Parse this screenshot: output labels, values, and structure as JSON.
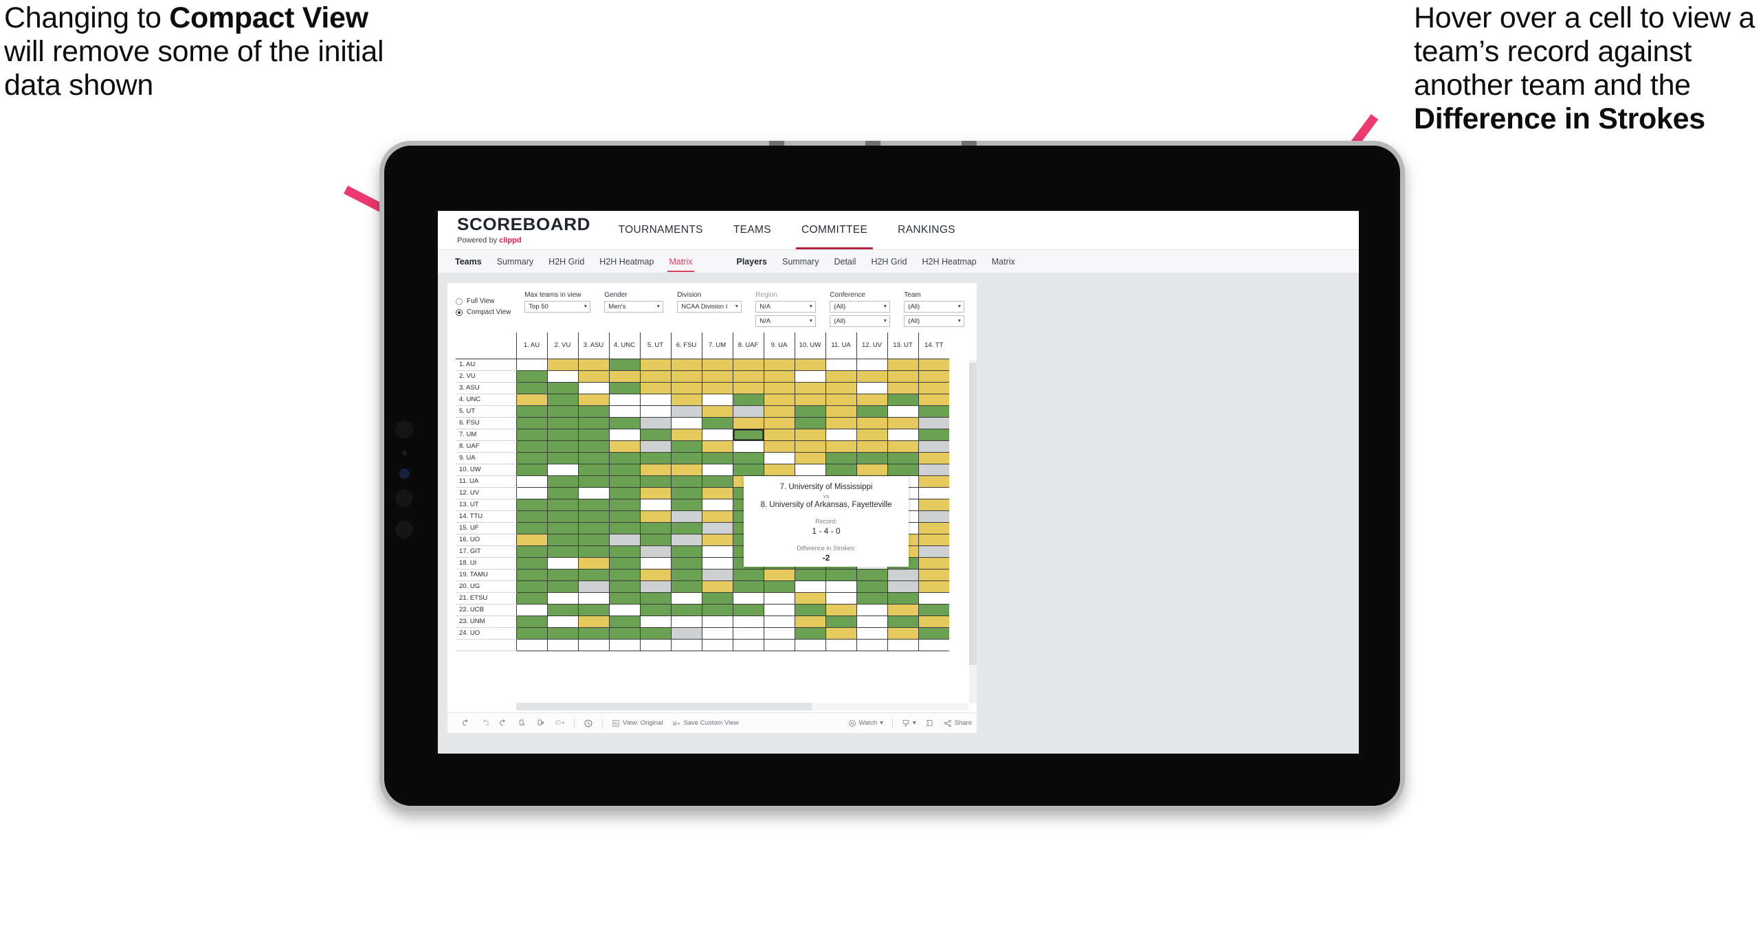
{
  "annotations": {
    "left": {
      "p1": "Changing to ",
      "b1": "Compact View",
      "p2": " will remove some of the initial data shown"
    },
    "right": {
      "p1": "Hover over a cell to view a team’s record against another team and the ",
      "b1": "Difference in Strokes"
    },
    "arrow_color": "#ec3a6f"
  },
  "app": {
    "brand": {
      "name": "SCOREBOARD",
      "powered_prefix": "Powered by ",
      "powered_brand": "clippd"
    },
    "topnav": [
      {
        "label": "TOURNAMENTS",
        "active": false
      },
      {
        "label": "TEAMS",
        "active": false
      },
      {
        "label": "COMMITTEE",
        "active": true
      },
      {
        "label": "RANKINGS",
        "active": false
      }
    ],
    "subnav": {
      "teams_group": [
        {
          "label": "Teams",
          "kind": "head"
        },
        {
          "label": "Summary",
          "kind": "item"
        },
        {
          "label": "H2H Grid",
          "kind": "item"
        },
        {
          "label": "H2H Heatmap",
          "kind": "item"
        },
        {
          "label": "Matrix",
          "kind": "selected"
        }
      ],
      "players_group": [
        {
          "label": "Players",
          "kind": "head"
        },
        {
          "label": "Summary",
          "kind": "item"
        },
        {
          "label": "Detail",
          "kind": "item"
        },
        {
          "label": "H2H Grid",
          "kind": "item"
        },
        {
          "label": "H2H Heatmap",
          "kind": "item"
        },
        {
          "label": "Matrix",
          "kind": "item"
        }
      ]
    }
  },
  "filters": {
    "view_mode": {
      "full_label": "Full View",
      "compact_label": "Compact View",
      "selected": "Compact View"
    },
    "max_teams": {
      "label": "Max teams in view",
      "value": "Top 50"
    },
    "gender": {
      "label": "Gender",
      "value": "Men's"
    },
    "division": {
      "label": "Division",
      "value": "NCAA Division I"
    },
    "region": {
      "label": "Region",
      "value1": "N/A",
      "value2": "N/A"
    },
    "conference": {
      "label": "Conference",
      "value1": "(All)",
      "value2": "(All)"
    },
    "team": {
      "label": "Team",
      "value1": "(All)",
      "value2": "(All)"
    }
  },
  "tooltip": {
    "team_a": "7. University of Mississippi",
    "vs": "vs",
    "team_b": "8. University of Arkansas, Fayetteville",
    "record_label": "Record:",
    "record_value": "1 - 4 - 0",
    "diff_label": "Difference in Strokes:",
    "diff_value": "-2"
  },
  "toolbar": {
    "items": [
      {
        "name": "undo",
        "label": "",
        "icon": "undo-icon"
      },
      {
        "name": "redo",
        "label": "",
        "icon": "redo-icon"
      },
      {
        "name": "revert",
        "label": "",
        "icon": "revert-icon"
      },
      {
        "name": "refresh",
        "label": "",
        "icon": "refresh-data-icon"
      },
      {
        "name": "pause",
        "label": "",
        "icon": "pause-updates-icon"
      },
      {
        "name": "alerts",
        "label": "",
        "icon": "alert-icon"
      }
    ],
    "view_original": "View: Original",
    "save_custom_view": "Save Custom View",
    "watch": "Watch",
    "share": "Share"
  },
  "chart_data": {
    "type": "heatmap",
    "title": "Team Head-to-Head Matrix",
    "legend_colors": {
      "win": "#6aa152",
      "loss": "#e5cb5d",
      "tie": "#cfd0d1",
      "none": "#ffffff"
    },
    "columns": [
      "1. AU",
      "2. VU",
      "3. ASU",
      "4. UNC",
      "5. UT",
      "6. FSU",
      "7. UM",
      "8. UAF",
      "9. UA",
      "10. UW",
      "11. UA",
      "12. UV",
      "13. UT",
      "14. TT"
    ],
    "rows": [
      "1. AU",
      "2. VU",
      "3. ASU",
      "4. UNC",
      "5. UT",
      "6. FSU",
      "7. UM",
      "8. UAF",
      "9. UA",
      "10. UW",
      "11. UA",
      "12. UV",
      "13. UT",
      "14. TTU",
      "15. UF",
      "16. UO",
      "17. GIT",
      "18. UI",
      "19. TAMU",
      "20. UG",
      "21. ETSU",
      "22. UCB",
      "23. UNM",
      "24. UO"
    ],
    "selected_cell": {
      "row": "7. UM",
      "col": "8. UAF"
    },
    "cells": [
      [
        "w",
        "y",
        "y",
        "g",
        "y",
        "y",
        "y",
        "y",
        "y",
        "y",
        "w",
        "w",
        "y",
        "y"
      ],
      [
        "g",
        "w",
        "y",
        "y",
        "y",
        "y",
        "y",
        "y",
        "y",
        "w",
        "y",
        "y",
        "y",
        "y"
      ],
      [
        "g",
        "g",
        "w",
        "g",
        "y",
        "y",
        "y",
        "y",
        "y",
        "y",
        "y",
        "w",
        "y",
        "y"
      ],
      [
        "y",
        "g",
        "y",
        "w",
        "w",
        "y",
        "w",
        "g",
        "y",
        "y",
        "y",
        "y",
        "g",
        "y"
      ],
      [
        "g",
        "g",
        "g",
        "w",
        "w",
        "s",
        "y",
        "s",
        "y",
        "g",
        "y",
        "g",
        "w",
        "g"
      ],
      [
        "g",
        "g",
        "g",
        "g",
        "s",
        "w",
        "g",
        "y",
        "y",
        "g",
        "y",
        "y",
        "y",
        "s"
      ],
      [
        "g",
        "g",
        "g",
        "w",
        "g",
        "y",
        "w",
        "g",
        "y",
        "y",
        "w",
        "y",
        "w",
        "g"
      ],
      [
        "g",
        "g",
        "g",
        "y",
        "s",
        "g",
        "y",
        "w",
        "y",
        "y",
        "y",
        "y",
        "y",
        "s"
      ],
      [
        "g",
        "g",
        "g",
        "g",
        "g",
        "g",
        "g",
        "g",
        "w",
        "y",
        "g",
        "g",
        "g",
        "y"
      ],
      [
        "g",
        "w",
        "g",
        "g",
        "y",
        "y",
        "w",
        "g",
        "y",
        "w",
        "g",
        "y",
        "g",
        "s"
      ],
      [
        "w",
        "g",
        "g",
        "g",
        "g",
        "g",
        "g",
        "y",
        "g",
        "w",
        "w",
        "g",
        "w",
        "y"
      ],
      [
        "w",
        "g",
        "w",
        "g",
        "y",
        "g",
        "y",
        "g",
        "g",
        "g",
        "w",
        "w",
        "w",
        "w"
      ],
      [
        "g",
        "g",
        "g",
        "g",
        "w",
        "g",
        "w",
        "g",
        "g",
        "g",
        "y",
        "g",
        "w",
        "y"
      ],
      [
        "g",
        "g",
        "g",
        "g",
        "y",
        "s",
        "y",
        "g",
        "g",
        "y",
        "w",
        "g",
        "w",
        "s"
      ],
      [
        "g",
        "g",
        "g",
        "g",
        "g",
        "g",
        "s",
        "g",
        "g",
        "g",
        "w",
        "g",
        "w",
        "y"
      ],
      [
        "y",
        "g",
        "g",
        "s",
        "g",
        "s",
        "y",
        "g",
        "g",
        "g",
        "g",
        "g",
        "y",
        "y"
      ],
      [
        "g",
        "g",
        "g",
        "g",
        "s",
        "g",
        "w",
        "g",
        "g",
        "g",
        "w",
        "s",
        "y",
        "s"
      ],
      [
        "g",
        "w",
        "y",
        "g",
        "w",
        "g",
        "w",
        "g",
        "g",
        "g",
        "g",
        "w",
        "g",
        "y"
      ],
      [
        "g",
        "g",
        "g",
        "g",
        "y",
        "g",
        "s",
        "g",
        "y",
        "g",
        "g",
        "g",
        "s",
        "y"
      ],
      [
        "g",
        "g",
        "s",
        "g",
        "s",
        "g",
        "y",
        "g",
        "g",
        "w",
        "w",
        "g",
        "s",
        "y"
      ],
      [
        "g",
        "w",
        "w",
        "g",
        "g",
        "w",
        "g",
        "w",
        "w",
        "y",
        "w",
        "g",
        "g",
        "w"
      ],
      [
        "w",
        "g",
        "g",
        "w",
        "g",
        "g",
        "g",
        "g",
        "w",
        "g",
        "y",
        "w",
        "y",
        "g"
      ],
      [
        "g",
        "w",
        "y",
        "g",
        "w",
        "w",
        "w",
        "w",
        "w",
        "y",
        "g",
        "w",
        "g",
        "y"
      ],
      [
        "g",
        "g",
        "g",
        "g",
        "g",
        "s",
        "w",
        "w",
        "w",
        "g",
        "y",
        "w",
        "y",
        "g"
      ]
    ]
  }
}
